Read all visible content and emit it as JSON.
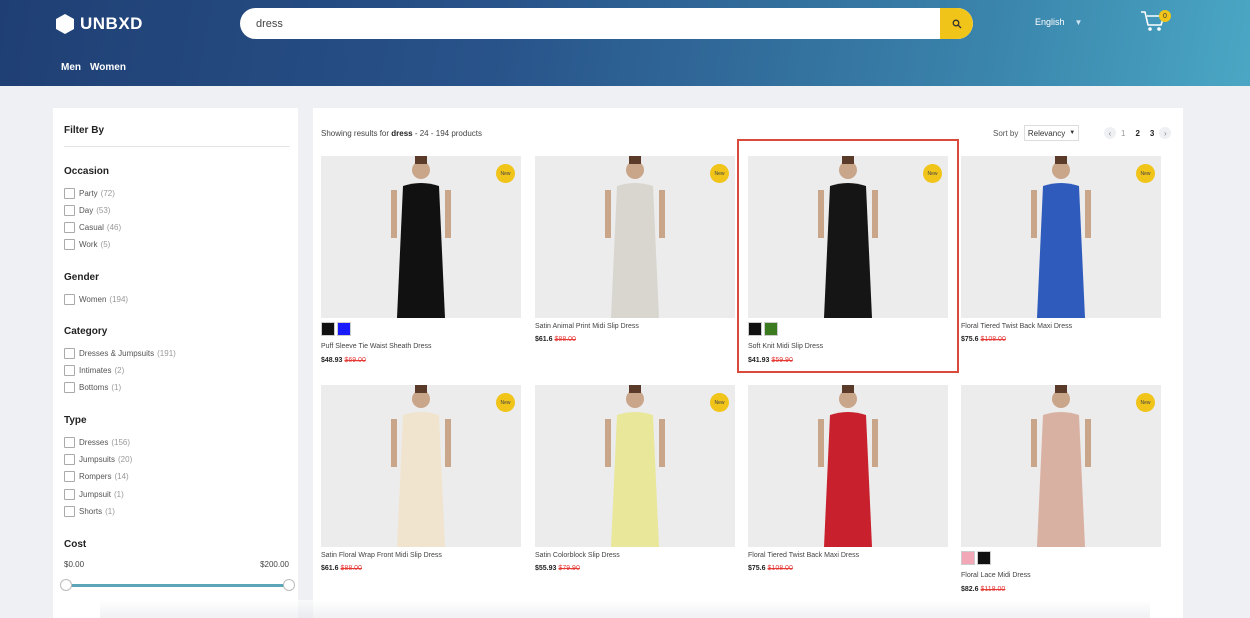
{
  "header": {
    "logo_text": "UNBXD",
    "search_value": "dress",
    "language": "English",
    "cart_count": "0",
    "nav": [
      "Men",
      "Women"
    ]
  },
  "filters": {
    "title": "Filter By",
    "facets": [
      {
        "title": "Occasion",
        "items": [
          [
            "Party",
            "(72)"
          ],
          [
            "Day",
            "(53)"
          ],
          [
            "Casual",
            "(46)"
          ],
          [
            "Work",
            "(5)"
          ]
        ]
      },
      {
        "title": "Gender",
        "items": [
          [
            "Women",
            "(194)"
          ]
        ]
      },
      {
        "title": "Category",
        "items": [
          [
            "Dresses & Jumpsuits",
            "(191)"
          ],
          [
            "Intimates",
            "(2)"
          ],
          [
            "Bottoms",
            "(1)"
          ]
        ]
      },
      {
        "title": "Type",
        "items": [
          [
            "Dresses",
            "(156)"
          ],
          [
            "Jumpsuits",
            "(20)"
          ],
          [
            "Rompers",
            "(14)"
          ],
          [
            "Jumpsuit",
            "(1)"
          ],
          [
            "Shorts",
            "(1)"
          ]
        ]
      }
    ],
    "cost": {
      "title": "Cost",
      "min": "$0.00",
      "max": "$200.00"
    }
  },
  "results": {
    "prefix": "Showing results for ",
    "query": "dress",
    "suffix": " - 24 - 194 products",
    "sort_label": "Sort by",
    "sort_value": "Relevancy",
    "pages": [
      "1",
      "2",
      "3"
    ],
    "current_page": "2"
  },
  "products": [
    {
      "name": "Puff Sleeve Tie Waist Sheath Dress",
      "price": "$48.93",
      "old_price": "$69.00",
      "new": true,
      "badge": "New",
      "swatches": [
        "#111111",
        "#1a1aff"
      ],
      "dress_color": "#111111"
    },
    {
      "name": "Satin Animal Print Midi Slip Dress",
      "price": "$61.6",
      "old_price": "$88.00",
      "new": true,
      "badge": "New",
      "swatches": [],
      "dress_color": "#d8d6cf"
    },
    {
      "name": "Soft Knit Midi Slip Dress",
      "price": "$41.93",
      "old_price": "$59.90",
      "new": true,
      "badge": "New",
      "swatches": [
        "#111111",
        "#3c7a1f"
      ],
      "dress_color": "#151515"
    },
    {
      "name": "Floral Tiered Twist Back Maxi Dress",
      "price": "$75.6",
      "old_price": "$108.00",
      "new": true,
      "badge": "New",
      "swatches": [],
      "dress_color": "#2f5bbd"
    },
    {
      "name": "Satin Floral Wrap Front Midi Slip Dress",
      "price": "$61.6",
      "old_price": "$88.00",
      "new": true,
      "badge": "New",
      "swatches": [],
      "dress_color": "#f1e4cf"
    },
    {
      "name": "Satin Colorblock Slip Dress",
      "price": "$55.93",
      "old_price": "$79.90",
      "new": true,
      "badge": "New",
      "swatches": [],
      "dress_color": "#e9e79a"
    },
    {
      "name": "Floral Tiered Twist Back Maxi Dress",
      "price": "$75.6",
      "old_price": "$108.00",
      "new": false,
      "badge": "",
      "swatches": [],
      "dress_color": "#c8202c"
    },
    {
      "name": "Floral Lace Midi Dress",
      "price": "$82.6",
      "old_price": "$118.00",
      "new": true,
      "badge": "New",
      "swatches": [
        "#f3a8b7",
        "#111111"
      ],
      "dress_color": "#d8b1a2"
    }
  ]
}
